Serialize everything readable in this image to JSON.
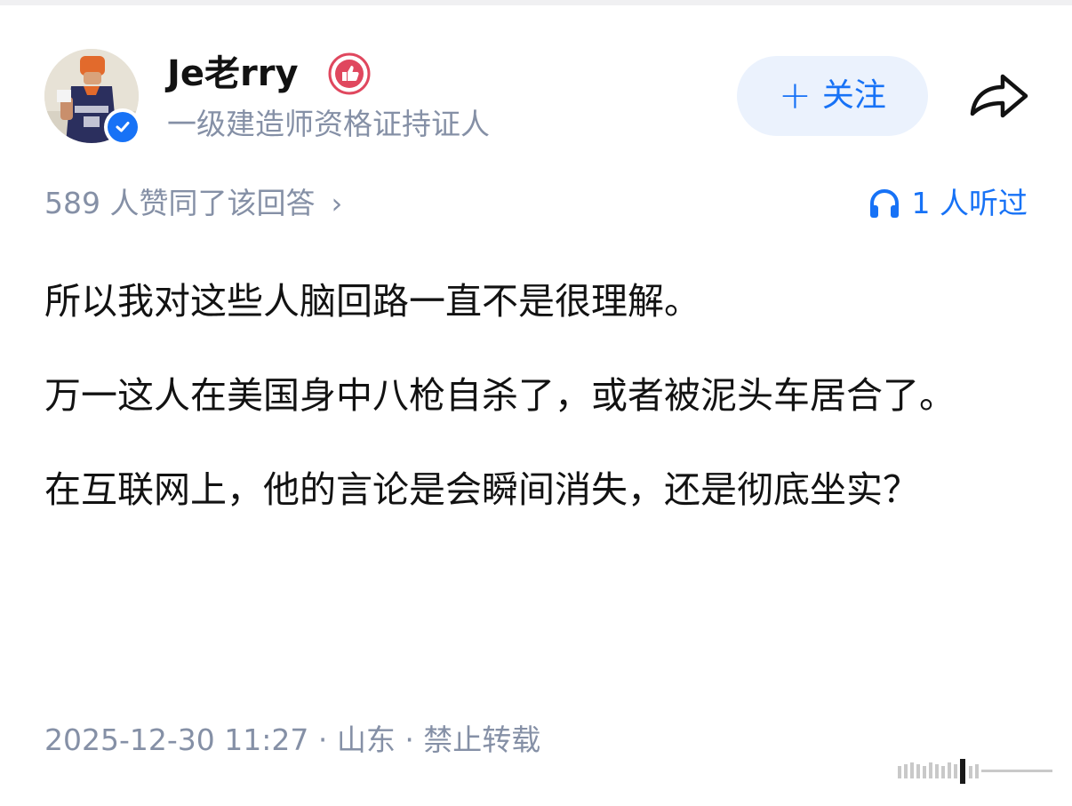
{
  "author": {
    "name": "Je老rry",
    "title": "一级建造师资格证持证人"
  },
  "actions": {
    "follow_plus": "+",
    "follow_label": "关注"
  },
  "meta": {
    "votes_text": "589 人赞同了该回答",
    "votes_chevron": "›",
    "listened_text": "1 人听过"
  },
  "content": {
    "paragraphs": [
      "所以我对这些人脑回路一直不是很理解。",
      "万一这人在美国身中八枪自杀了，或者被泥头车居合了。",
      "在互联网上，他的言论是会瞬间消失，还是彻底坐实？"
    ]
  },
  "footer": {
    "info": "2025-12-30 11:27 · 山东 · 禁止转载"
  },
  "icons": {
    "verified": "verified-check-icon",
    "badge": "thumbs-up-badge-icon",
    "share": "share-arrow-icon",
    "headphones": "headphones-icon"
  },
  "colors": {
    "brand_blue": "#1772f6",
    "secondary_text": "#8590a6",
    "follow_bg": "#ebf2fd",
    "badge_red": "#e0475e"
  }
}
